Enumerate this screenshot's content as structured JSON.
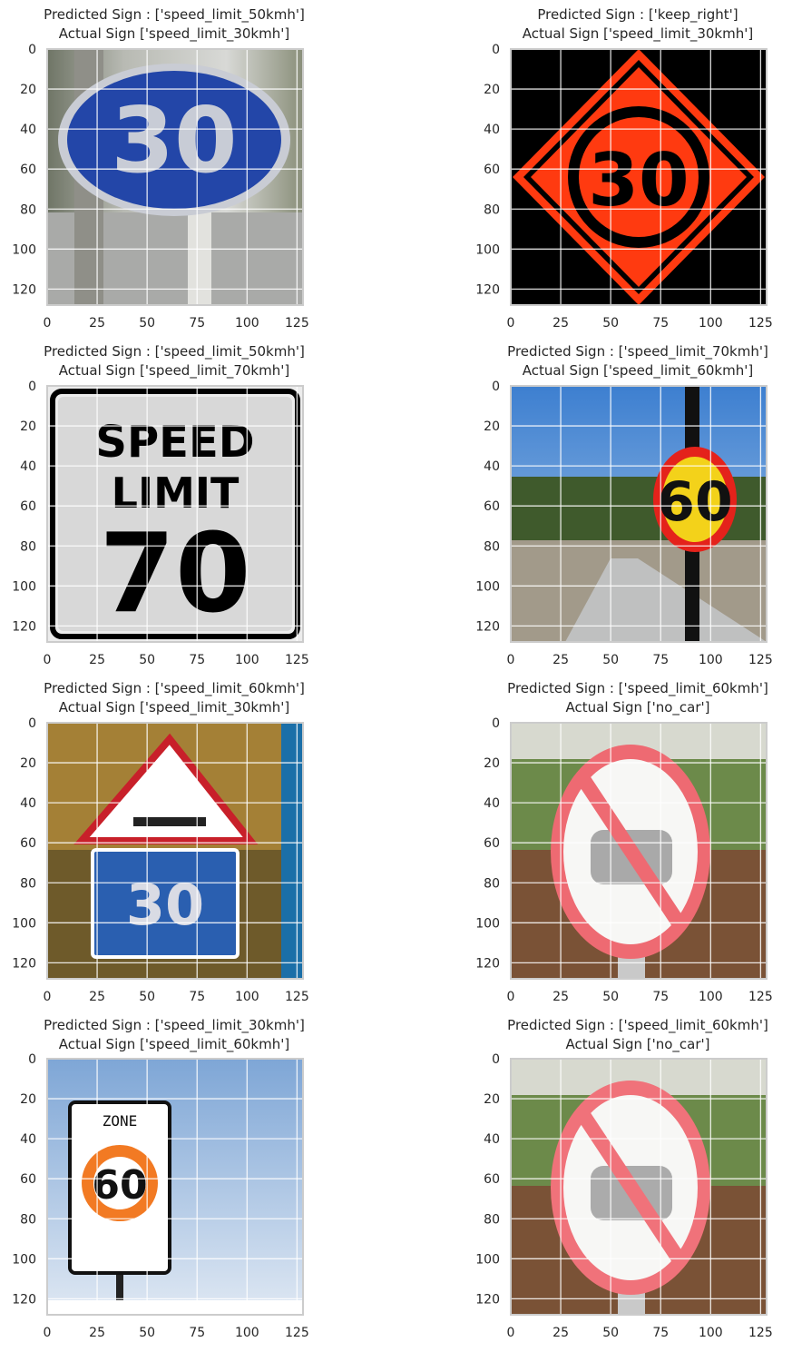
{
  "axis": {
    "xlim": [
      0,
      128
    ],
    "ylim": [
      128,
      0
    ],
    "xticks": [
      "0",
      "25",
      "50",
      "75",
      "100",
      "125"
    ],
    "yticks": [
      "0",
      "20",
      "40",
      "60",
      "80",
      "100",
      "120"
    ]
  },
  "panels": [
    {
      "predicted": "Predicted Sign : ['speed_limit_50kmh']",
      "actual": "Actual Sign ['speed_limit_30kmh']",
      "image": "blue-oval-30-sign",
      "sign_text": "30"
    },
    {
      "predicted": "Predicted Sign : ['keep_right']",
      "actual": "Actual Sign ['speed_limit_30kmh']",
      "image": "orange-diamond-30-sign",
      "sign_text": "30"
    },
    {
      "predicted": "Predicted Sign : ['speed_limit_50kmh']",
      "actual": "Actual Sign ['speed_limit_70kmh']",
      "image": "speed-limit-70-sign",
      "sign_lines": [
        "SPEED",
        "LIMIT",
        "70"
      ]
    },
    {
      "predicted": "Predicted Sign : ['speed_limit_70kmh']",
      "actual": "Actual Sign ['speed_limit_60kmh']",
      "image": "yellow-round-60-sign",
      "sign_text": "60"
    },
    {
      "predicted": "Predicted Sign : ['speed_limit_60kmh']",
      "actual": "Actual Sign ['speed_limit_30kmh']",
      "image": "triangle-bump-30-sign",
      "sign_text": "30"
    },
    {
      "predicted": "Predicted Sign : ['speed_limit_60kmh']",
      "actual": "Actual Sign ['no_car']",
      "image": "no-car-sign"
    },
    {
      "predicted": "Predicted Sign : ['speed_limit_30kmh']",
      "actual": "Actual Sign ['speed_limit_60kmh']",
      "image": "zone-60-sign",
      "sign_lines": [
        "ZONE",
        "60"
      ]
    },
    {
      "predicted": "Predicted Sign : ['speed_limit_60kmh']",
      "actual": "Actual Sign ['no_car']",
      "image": "no-car-sign"
    }
  ]
}
